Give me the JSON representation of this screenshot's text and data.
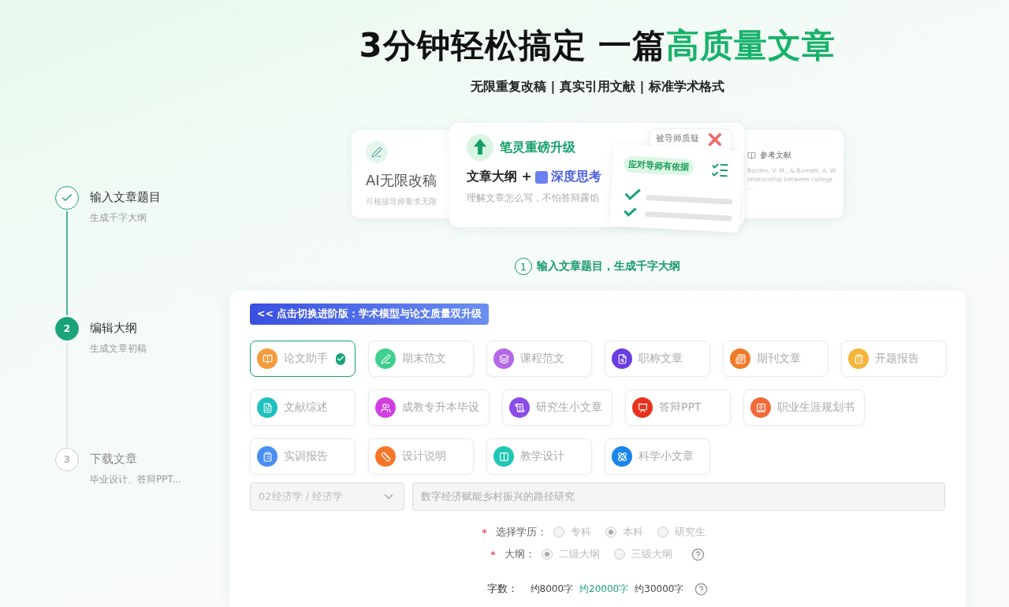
{
  "steps": [
    {
      "title": "输入文章题目",
      "subtitle": "生成千字大纲",
      "kind": "done"
    },
    {
      "number": "2",
      "title": "编辑大纲",
      "subtitle": "生成文章初稿",
      "kind": "active"
    },
    {
      "number": "3",
      "title": "下载文章",
      "subtitle": "毕业设计、答辩PPT...",
      "kind": "pending"
    }
  ],
  "header": {
    "title_plain": "3分钟轻松搞定 一篇",
    "title_highlight": "高质量文章",
    "subtitle": "无限重复改稿 | 真实引用文献 | 标准学术格式"
  },
  "banner": {
    "left_card": {
      "title": "AI无限改稿",
      "text": "可根据导师要求无限"
    },
    "center_card": {
      "title": "笔灵重磅升级",
      "line_plain": "文章大纲 +",
      "line_highlight": "深度思考",
      "text": "理解文章怎么写，不怕答辩露馅"
    },
    "doubt_card": {
      "text": "被导师质疑"
    },
    "proof_card": {
      "tag": "应对导师有依据"
    },
    "ref_card": {
      "title": "参考文献",
      "text": "Borden, V. M., & Burnett, A. W. relationship between college ..."
    }
  },
  "current_step": {
    "number": "1",
    "text": "输入文章题目，生成千字大纲"
  },
  "upgrade_button": "<< 点击切换进阶版：学术模型与论文质量双升级",
  "type_rows": [
    {
      "items": [
        {
          "label": "论文助手",
          "color": "#f59a3c",
          "selected": true
        },
        {
          "label": "期末范文",
          "color": "#3fcf8e",
          "selected": false
        },
        {
          "label": "课程范文",
          "color": "#b468e8",
          "selected": false
        },
        {
          "label": "职称文章",
          "color": "#6a3de0",
          "selected": false
        },
        {
          "label": "期刊文章",
          "color": "#f07a28",
          "selected": false
        },
        {
          "label": "开题报告",
          "color": "#f5b53a",
          "selected": false
        }
      ]
    },
    {
      "items": [
        {
          "label": "文献综述",
          "color": "#20c0c0",
          "selected": false
        },
        {
          "label": "成教专升本毕设",
          "color": "#d23ee0",
          "selected": false
        },
        {
          "label": "研究生小文章",
          "color": "#8a4de8",
          "selected": false
        },
        {
          "label": "答辩PPT",
          "color": "#e8321e",
          "selected": false
        },
        {
          "label": "职业生涯规划书",
          "color": "#f06a3a",
          "selected": false
        }
      ]
    },
    {
      "items": [
        {
          "label": "实训报告",
          "color": "#4a8ef0",
          "selected": false
        },
        {
          "label": "设计说明",
          "color": "#f5762a",
          "selected": false
        },
        {
          "label": "教学设计",
          "color": "#1fc7b4",
          "selected": false
        },
        {
          "label": "科学小文章",
          "color": "#1a86e8",
          "selected": false
        }
      ]
    }
  ],
  "subject_select": {
    "value": "02经济学 / 经济学",
    "disabled": true
  },
  "topic_input": {
    "value": "数字经济赋能乡村振兴的路径研究",
    "disabled": true
  },
  "education": {
    "required_mark": "*",
    "label": "选择学历：",
    "options": [
      {
        "label": "专科",
        "selected": false
      },
      {
        "label": "本科",
        "selected": true
      },
      {
        "label": "研究生",
        "selected": false
      }
    ]
  },
  "outline": {
    "required_mark": "*",
    "label": "大纲：",
    "options": [
      {
        "label": "二级大纲",
        "selected": true
      },
      {
        "label": "三级大纲",
        "selected": false
      }
    ]
  },
  "word_count": {
    "label": "字数：",
    "options": [
      {
        "label": "约8000字",
        "selected": false
      },
      {
        "label": "约20000字",
        "selected": true
      },
      {
        "label": "约30000字",
        "selected": false
      }
    ]
  }
}
